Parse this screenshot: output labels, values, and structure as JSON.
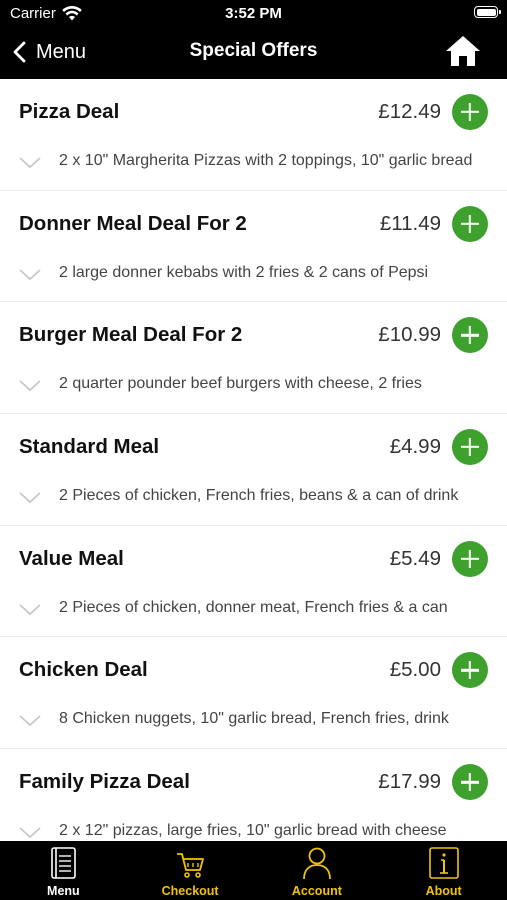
{
  "status_bar": {
    "carrier": "Carrier",
    "time": "3:52 PM"
  },
  "nav": {
    "back_label": "Menu",
    "title": "Special Offers"
  },
  "offers": [
    {
      "name": "Pizza Deal",
      "price": "£12.49",
      "description": "2 x 10\" Margherita Pizzas with 2 toppings, 10\" garlic bread"
    },
    {
      "name": "Donner Meal Deal For 2",
      "price": "£11.49",
      "description": "2 large donner kebabs with 2 fries & 2 cans of Pepsi"
    },
    {
      "name": "Burger Meal Deal For 2",
      "price": "£10.99",
      "description": "2 quarter pounder beef burgers with cheese, 2 fries"
    },
    {
      "name": "Standard Meal",
      "price": "£4.99",
      "description": "2 Pieces of chicken, French fries, beans & a can of drink"
    },
    {
      "name": "Value Meal",
      "price": "£5.49",
      "description": "2 Pieces of chicken, donner meat, French fries & a can"
    },
    {
      "name": "Chicken Deal",
      "price": "£5.00",
      "description": "8 Chicken nuggets, 10\" garlic bread, French fries, drink"
    },
    {
      "name": "Family Pizza Deal",
      "price": "£17.99",
      "description": "2 x 12\" pizzas, large fries, 10\" garlic bread with cheese"
    }
  ],
  "tabs": [
    {
      "label": "Menu",
      "icon": "menu-book-icon",
      "color": "#ffffff"
    },
    {
      "label": "Checkout",
      "icon": "cart-icon",
      "color": "#f2c300"
    },
    {
      "label": "Account",
      "icon": "person-icon",
      "color": "#f2c300"
    },
    {
      "label": "About",
      "icon": "info-icon",
      "color": "#f2c300"
    }
  ],
  "colors": {
    "accent_green": "#3ea12d",
    "tab_active": "#ffffff",
    "tab_inactive": "#f2c300",
    "bar_background": "#000000"
  }
}
